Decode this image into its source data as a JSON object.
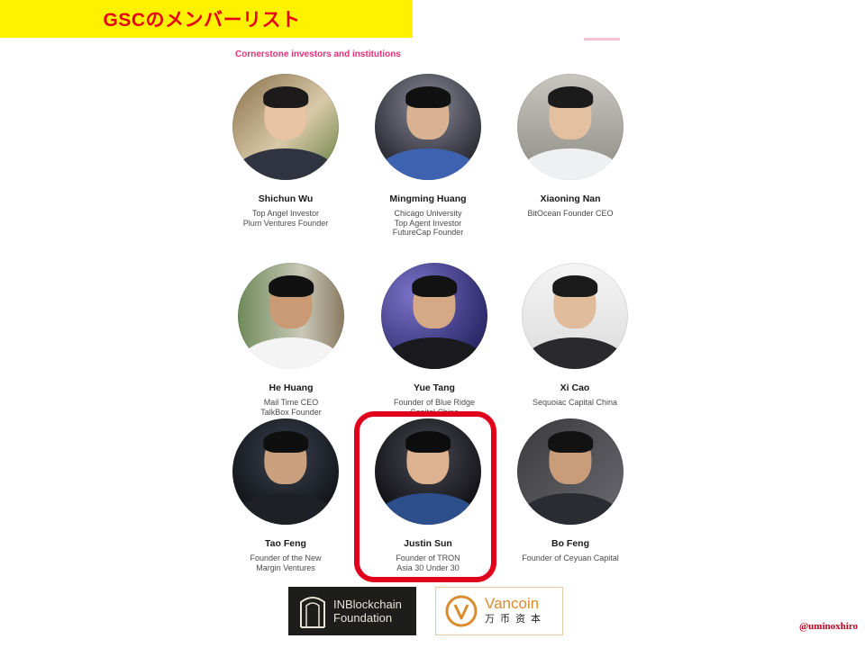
{
  "banner": {
    "title": "GSCのメンバーリスト"
  },
  "section": {
    "heading": "Cornerstone investors and institutions"
  },
  "members": [
    {
      "name": "Shichun Wu",
      "role": [
        "Top Angel Investor",
        "Plum Ventures Founder"
      ]
    },
    {
      "name": "Mingming Huang",
      "role": [
        "Chicago University",
        "Top Agent Investor",
        "FutureCap Founder"
      ]
    },
    {
      "name": "Xiaoning Nan",
      "role": [
        "BitOcean Founder CEO"
      ]
    },
    {
      "name": "He Huang",
      "role": [
        "Mail Time CEO",
        "TalkBox Founder"
      ]
    },
    {
      "name": "Yue Tang",
      "role": [
        "Founder of Blue Ridge",
        "Capital China"
      ]
    },
    {
      "name": "Xi Cao",
      "role": [
        "Sequoiac Capital China"
      ]
    },
    {
      "name": "Tao Feng",
      "role": [
        "Founder of the New",
        "Margin Ventures"
      ]
    },
    {
      "name": "Justin Sun",
      "role": [
        "Founder of TRON",
        "Asia 30 Under 30"
      ]
    },
    {
      "name": "Bo Feng",
      "role": [
        "Founder of Ceyuan Capital"
      ]
    }
  ],
  "logos": {
    "inblockchain": {
      "line1": "INBlockchain",
      "line2": "Foundation",
      "icon": "arch-icon"
    },
    "vancoin": {
      "name": "Vancoin",
      "chinese": "万币资本",
      "icon": "v-circle-icon"
    }
  },
  "highlight_color": "#e0001b",
  "banner_color": "#fff200",
  "credit": "@uminoxhiro"
}
